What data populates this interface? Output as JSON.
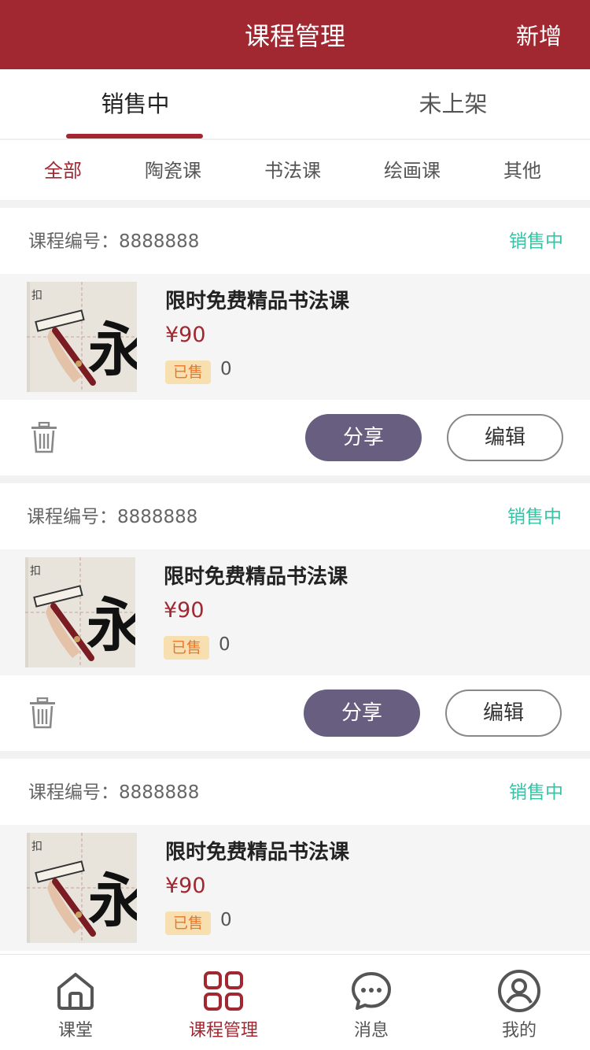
{
  "header": {
    "title": "课程管理",
    "add_label": "新增"
  },
  "tabs": [
    {
      "label": "销售中"
    },
    {
      "label": "未上架"
    }
  ],
  "categories": [
    "全部",
    "陶瓷课",
    "书法课",
    "绘画课",
    "其他"
  ],
  "courses": [
    {
      "code_label": "课程编号：8888888",
      "status": "销售中",
      "title": "限时免费精品书法课",
      "price": "¥90",
      "sold_label": "已售",
      "sold_count": "0",
      "share_label": "分享",
      "edit_label": "编辑"
    },
    {
      "code_label": "课程编号：8888888",
      "status": "销售中",
      "title": "限时免费精品书法课",
      "price": "¥90",
      "sold_label": "已售",
      "sold_count": "0",
      "share_label": "分享",
      "edit_label": "编辑"
    },
    {
      "code_label": "课程编号：8888888",
      "status": "销售中",
      "title": "限时免费精品书法课",
      "price": "¥90",
      "sold_label": "已售",
      "sold_count": "0"
    }
  ],
  "tabbar": [
    {
      "label": "课堂",
      "icon": "home-icon"
    },
    {
      "label": "课程管理",
      "icon": "grid-icon",
      "active": true
    },
    {
      "label": "消息",
      "icon": "chat-icon"
    },
    {
      "label": "我的",
      "icon": "user-icon"
    }
  ],
  "colors": {
    "brand": "#a12731",
    "status_green": "#35c4a5",
    "share_button": "#685e80",
    "sold_badge_bg": "#f8dfb0",
    "sold_badge_text": "#e8772a"
  }
}
